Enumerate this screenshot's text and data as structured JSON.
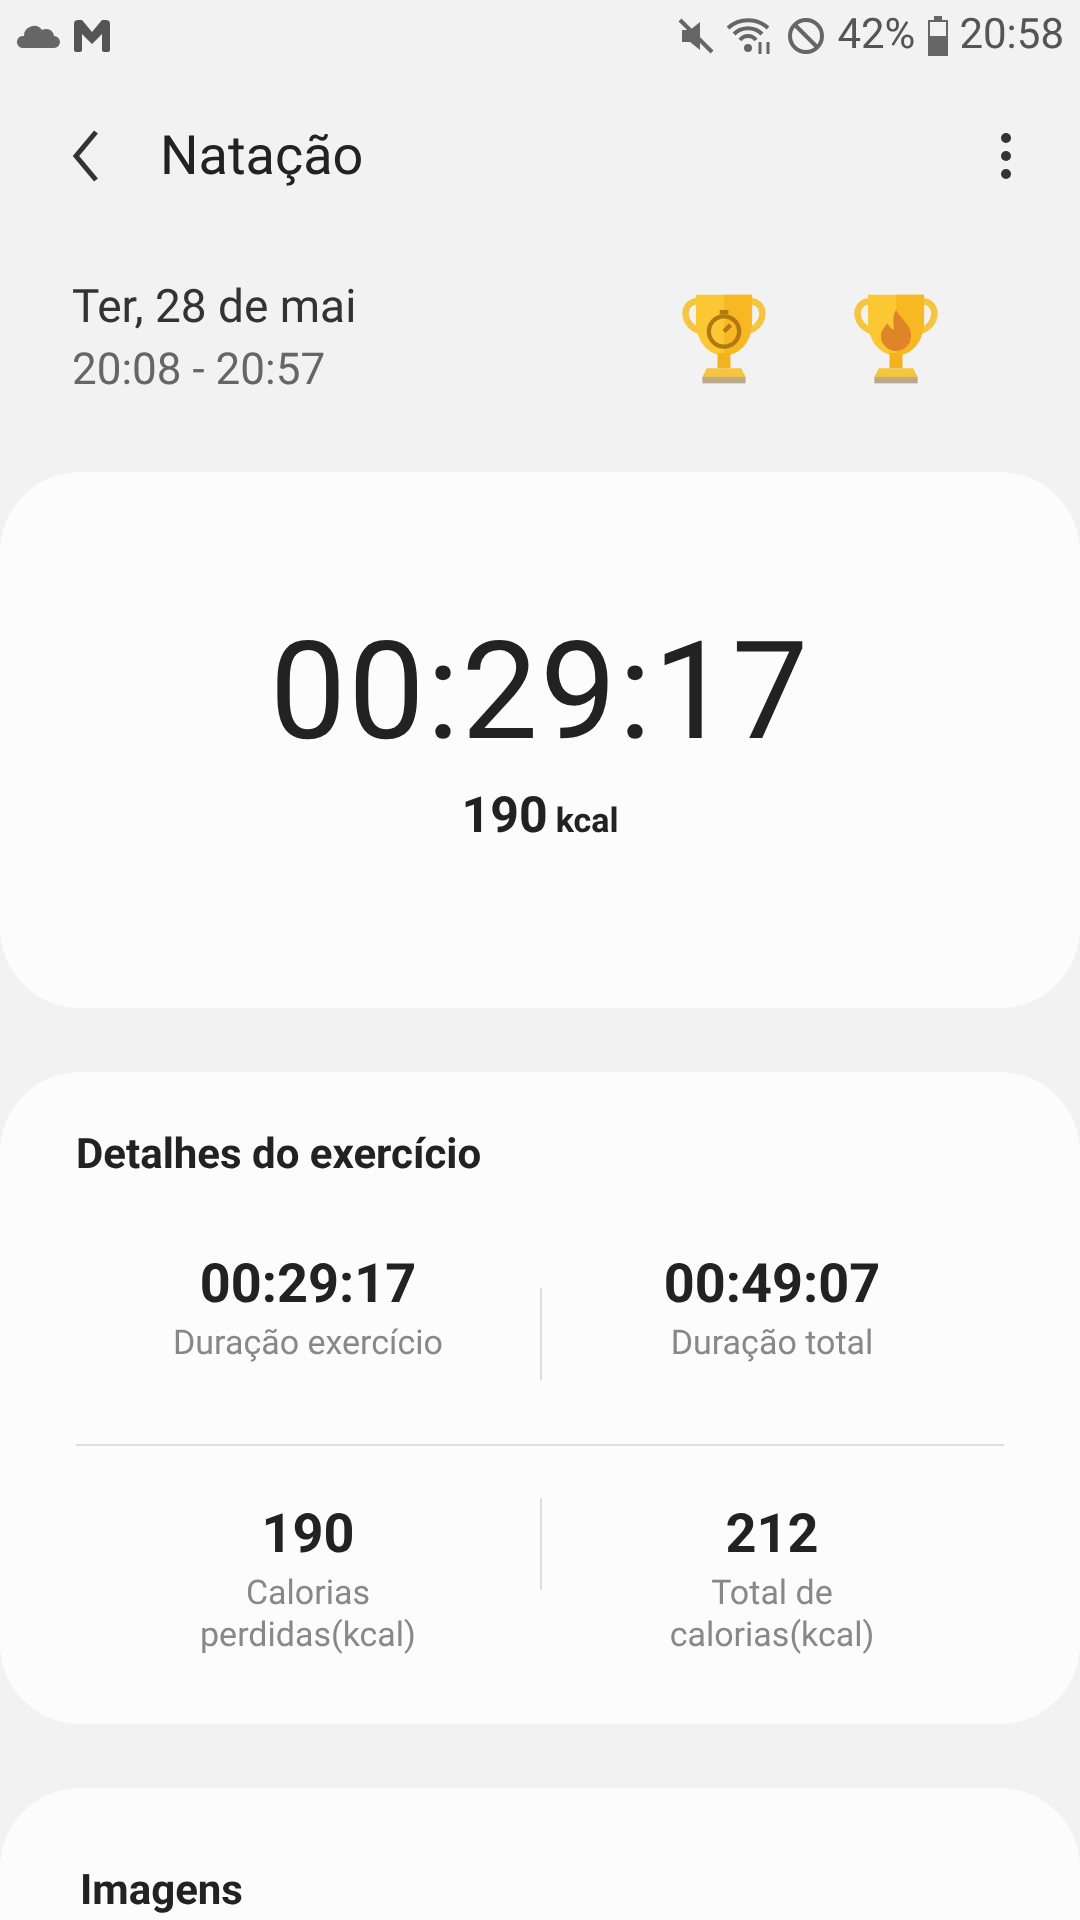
{
  "status_bar": {
    "battery": "42%",
    "time": "20:58"
  },
  "header": {
    "title": "Natação"
  },
  "session": {
    "date": "Ter, 28 de mai",
    "time_range": "20:08 - 20:57",
    "trophies": [
      {
        "kind": "stopwatch"
      },
      {
        "kind": "flame"
      }
    ]
  },
  "summary": {
    "duration": "00:29:17",
    "calories": "190",
    "calories_unit": "kcal"
  },
  "details": {
    "title": "Detalhes do exercício",
    "stats": [
      {
        "value": "00:29:17",
        "label": "Duração exercício"
      },
      {
        "value": "00:49:07",
        "label": "Duração total"
      },
      {
        "value": "190",
        "label": "Calorias perdidas(kcal)"
      },
      {
        "value": "212",
        "label": "Total de calorias(kcal)"
      }
    ]
  },
  "images": {
    "title": "Imagens"
  }
}
